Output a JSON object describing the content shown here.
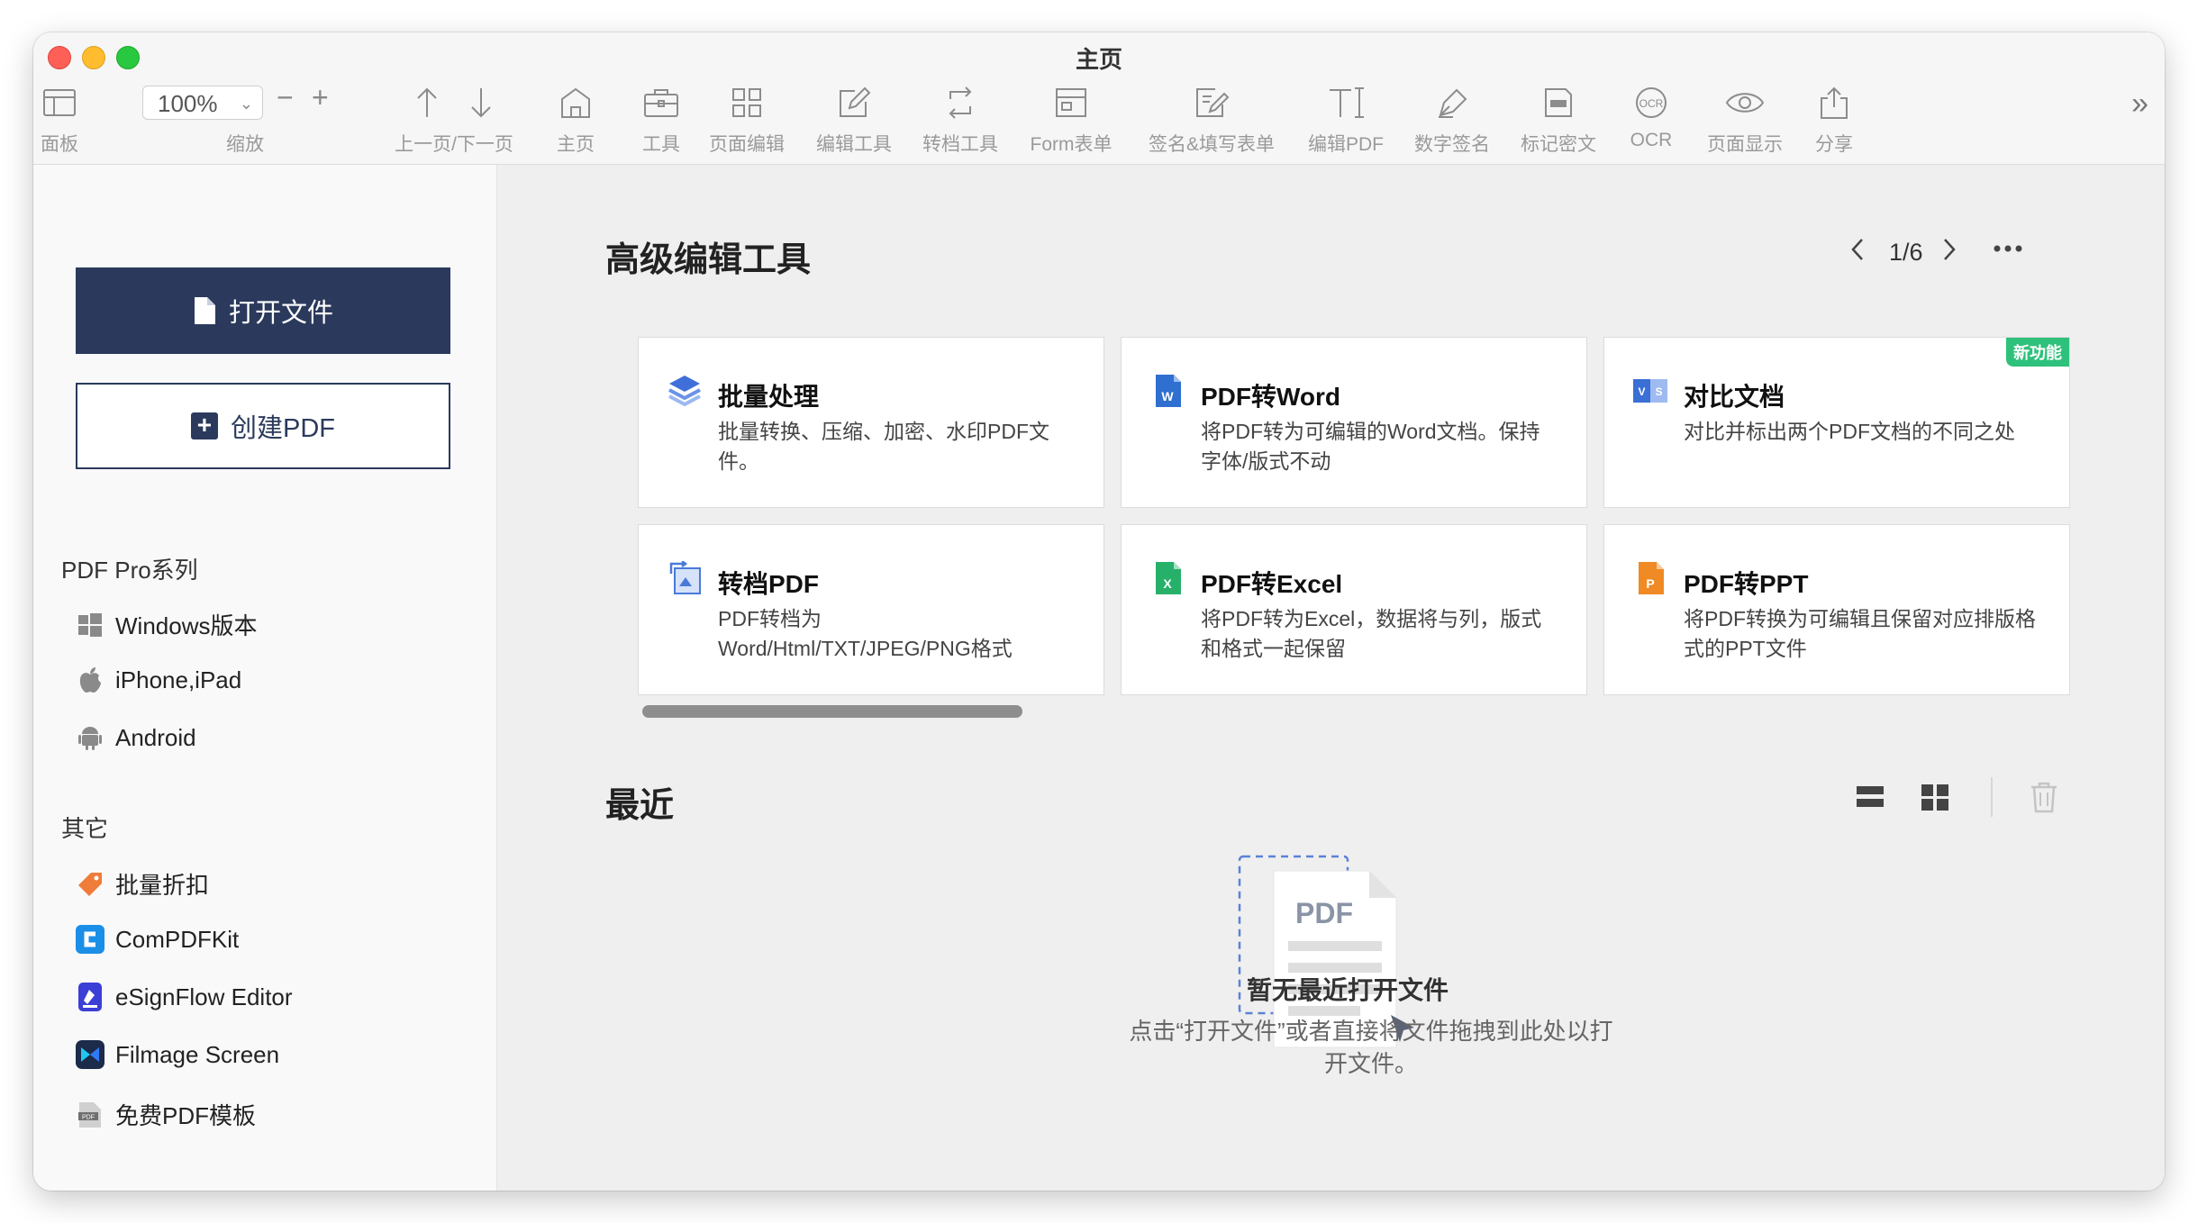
{
  "window": {
    "title": "主页"
  },
  "toolbar": {
    "panel": "面板",
    "zoom_value": "100%",
    "zoom_label": "缩放",
    "prev_next": "上一页/下一页",
    "home": "主页",
    "tools": "工具",
    "page_edit": "页面编辑",
    "edit_tools": "编辑工具",
    "convert_tools": "转档工具",
    "form": "Form表单",
    "sign_fill": "签名&填写表单",
    "edit_pdf": "编辑PDF",
    "digital_sign": "数字签名",
    "redact": "标记密文",
    "ocr": "OCR",
    "page_display": "页面显示",
    "share": "分享"
  },
  "sidebar": {
    "open_file": "打开文件",
    "create_pdf": "创建PDF",
    "section_pro": "PDF Pro系列",
    "pro_items": [
      "Windows版本",
      "iPhone,iPad",
      "Android"
    ],
    "section_other": "其它",
    "other_items": [
      "批量折扣",
      "ComPDFKit",
      "eSignFlow Editor",
      "Filmage Screen",
      "免费PDF模板"
    ]
  },
  "main": {
    "advanced_title": "高级编辑工具",
    "pager": "1/6",
    "recent_title": "最近",
    "new_badge": "新功能",
    "cards": [
      {
        "title": "批量处理",
        "desc": "批量转换、压缩、加密、水印PDF文件。",
        "icon": "layers-icon",
        "color": "#3f6fd8"
      },
      {
        "title": "PDF转Word",
        "desc": "将PDF转为可编辑的Word文档。保持字体/版式不动",
        "icon": "word-icon",
        "color": "#2f6fd0"
      },
      {
        "title": "对比文档",
        "desc": "对比并标出两个PDF文档的不同之处",
        "icon": "compare-icon",
        "color": "#3a6fd6"
      },
      {
        "title": "转档PDF",
        "desc": "PDF转档为Word/Html/TXT/JPEG/PNG格式",
        "icon": "convert-icon",
        "color": "#4a7ad8"
      },
      {
        "title": "PDF转Excel",
        "desc": "将PDF转为Excel，数据将与列，版式和格式一起保留",
        "icon": "excel-icon",
        "color": "#27b06a"
      },
      {
        "title": "PDF转PPT",
        "desc": "将PDF转换为可编辑且保留对应排版格式的PPT文件",
        "icon": "ppt-icon",
        "color": "#f08a24"
      }
    ],
    "empty": {
      "file_label": "PDF",
      "title": "暂无最近打开文件",
      "desc": "点击“打开文件”或者直接将文件拖拽到此处以打开文件。"
    }
  }
}
